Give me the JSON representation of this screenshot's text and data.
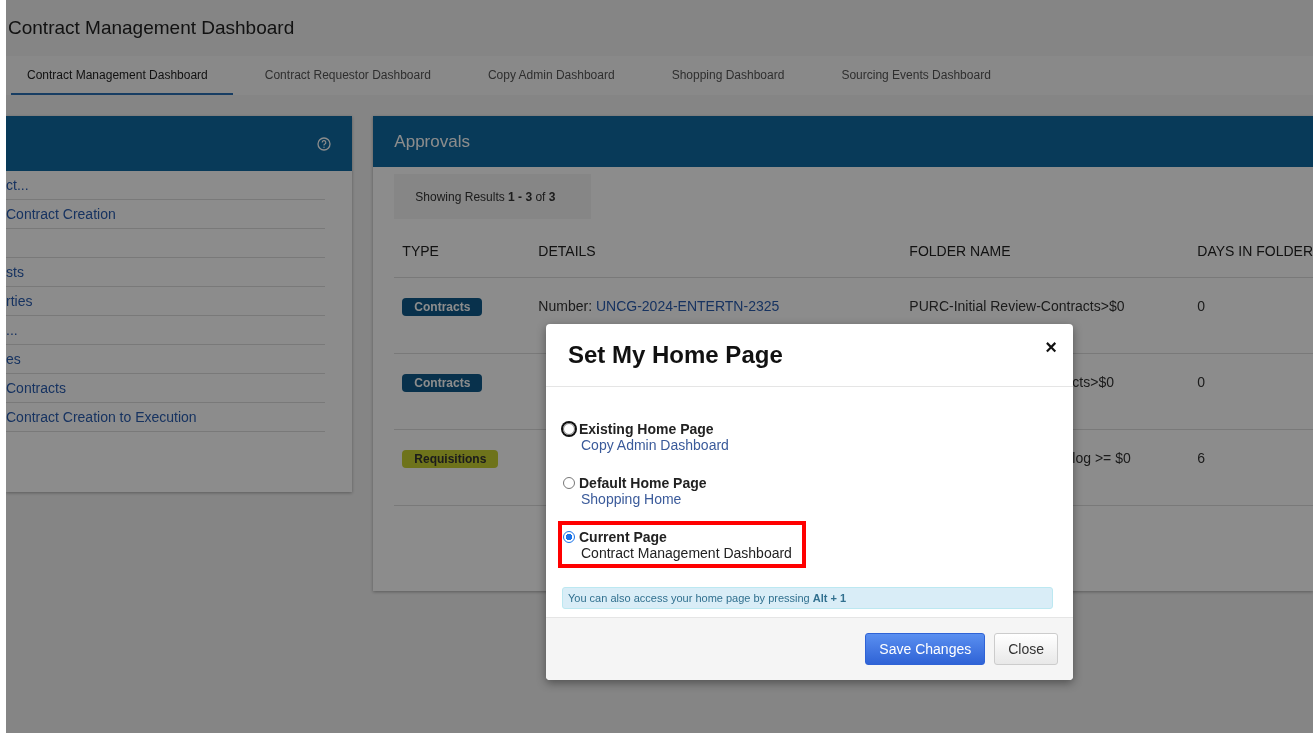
{
  "page_title": "Contract Management Dashboard",
  "tabs": [
    {
      "label": "Contract Management Dashboard",
      "selected": true
    },
    {
      "label": "Contract Requestor Dashboard",
      "selected": false
    },
    {
      "label": "Copy Admin Dashboard",
      "selected": false
    },
    {
      "label": "Shopping Dashboard",
      "selected": false
    },
    {
      "label": "Sourcing Events Dashboard",
      "selected": false
    }
  ],
  "left_panel": {
    "items": [
      {
        "kind": "link",
        "text": "ct..."
      },
      {
        "kind": "link",
        "text": "Contract Creation"
      },
      {
        "kind": "blank"
      },
      {
        "kind": "link",
        "text": "sts"
      },
      {
        "kind": "link",
        "text": "rties"
      },
      {
        "kind": "link",
        "text": "..."
      },
      {
        "kind": "link",
        "text": "es"
      },
      {
        "kind": "link",
        "text": "Contracts"
      },
      {
        "kind": "link",
        "text": "Contract Creation to Execution"
      }
    ]
  },
  "approvals": {
    "title": "Approvals",
    "results": "Showing Results **1 - 3** of **3**",
    "columns": [
      "TYPE",
      "DETAILS",
      "FOLDER NAME",
      "DAYS IN FOLDER"
    ],
    "rows": [
      {
        "type": "Contracts",
        "kind": "contract",
        "details_label": "Number: ",
        "details_link": "UNCG-2024-ENTERTN-2325",
        "folder": "PURC-Initial Review-Contracts>$0",
        "days": "0"
      },
      {
        "type": "Contracts",
        "kind": "contract",
        "folder": "cts>$0",
        "days": "0"
      },
      {
        "type": "Requisitions",
        "kind": "requisition",
        "folder": "log >= $0",
        "days": "6"
      }
    ]
  },
  "modal": {
    "title": "Set My Home Page",
    "close": "×",
    "options": [
      {
        "label": "Existing Home Page",
        "value": "Copy Admin Dashboard",
        "selected": false,
        "focused": true,
        "highlighted": false,
        "value_is_link": true
      },
      {
        "label": "Default Home Page",
        "value": "Shopping Home",
        "selected": false,
        "focused": false,
        "highlighted": false,
        "value_is_link": true
      },
      {
        "label": "Current Page",
        "value": "Contract Management Dashboard",
        "selected": true,
        "focused": false,
        "highlighted": true,
        "value_is_link": false
      }
    ],
    "hint": "You can also access your home page by pressing **Alt + 1**",
    "buttons": [
      {
        "label": "Save Changes",
        "kind": "primary"
      },
      {
        "label": "Close",
        "kind": "secondary"
      }
    ]
  }
}
